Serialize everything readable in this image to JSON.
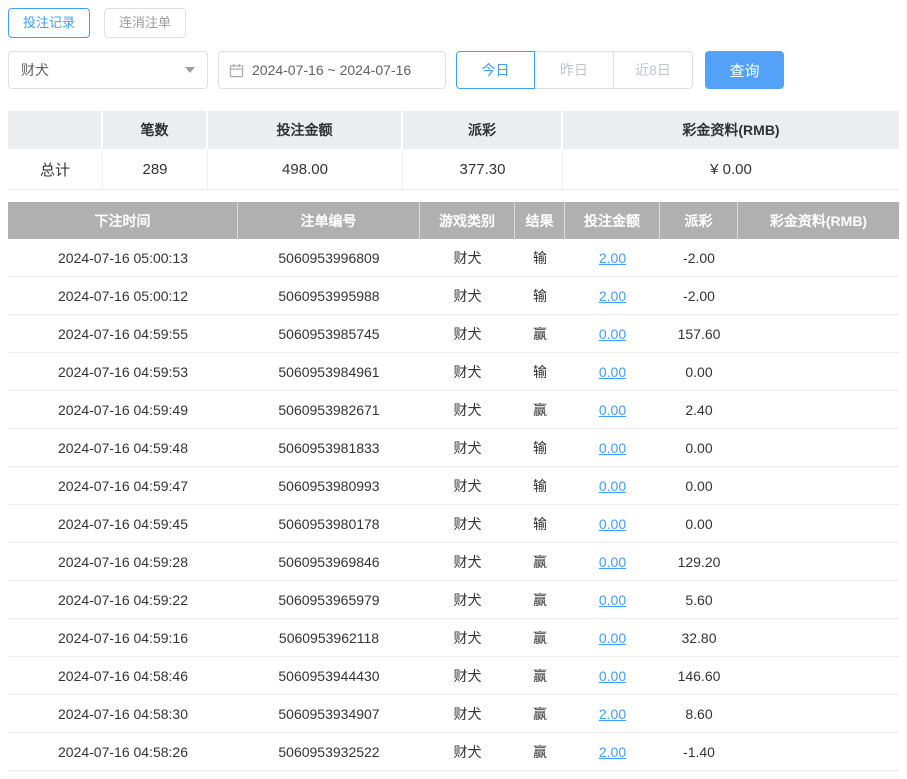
{
  "colors": {
    "accent": "#409eff",
    "search_button": "#53a2f7",
    "table_header_bg": "#b0b0b0",
    "summary_header_bg": "#ecedf1",
    "negative": "#ef5050",
    "link": "#409eff"
  },
  "icons": {
    "date_picker": "calendar-icon",
    "select_caret": "chevron-down-icon"
  },
  "tabs": [
    {
      "label": "投注记录",
      "active": true
    },
    {
      "label": "连消注单",
      "active": false
    }
  ],
  "filters": {
    "game_select": {
      "value": "财犬"
    },
    "date_range": "2024-07-16 ~ 2024-07-16",
    "quick_buttons": [
      {
        "label": "今日",
        "active": true
      },
      {
        "label": "昨日",
        "active": false
      },
      {
        "label": "近8日",
        "active": false
      }
    ],
    "search_label": "查询"
  },
  "summary": {
    "headers": [
      "",
      "笔数",
      "投注金额",
      "派彩",
      "彩金资料(RMB)"
    ],
    "row_label": "总计",
    "count": "289",
    "bet_amount": "498.00",
    "payout": "377.30",
    "bonus": "¥ 0.00"
  },
  "table": {
    "headers": [
      "下注时间",
      "注单编号",
      "游戏类别",
      "结果",
      "投注金额",
      "派彩",
      "彩金资料(RMB)"
    ],
    "rows": [
      {
        "time": "2024-07-16 05:00:13",
        "order_id": "5060953996809",
        "game": "财犬",
        "result": "输",
        "bet": "2.00",
        "payout": "-2.00",
        "bonus": ""
      },
      {
        "time": "2024-07-16 05:00:12",
        "order_id": "5060953995988",
        "game": "财犬",
        "result": "输",
        "bet": "2.00",
        "payout": "-2.00",
        "bonus": ""
      },
      {
        "time": "2024-07-16 04:59:55",
        "order_id": "5060953985745",
        "game": "财犬",
        "result": "赢",
        "bet": "0.00",
        "payout": "157.60",
        "bonus": ""
      },
      {
        "time": "2024-07-16 04:59:53",
        "order_id": "5060953984961",
        "game": "财犬",
        "result": "输",
        "bet": "0.00",
        "payout": "0.00",
        "bonus": ""
      },
      {
        "time": "2024-07-16 04:59:49",
        "order_id": "5060953982671",
        "game": "财犬",
        "result": "赢",
        "bet": "0.00",
        "payout": "2.40",
        "bonus": ""
      },
      {
        "time": "2024-07-16 04:59:48",
        "order_id": "5060953981833",
        "game": "财犬",
        "result": "输",
        "bet": "0.00",
        "payout": "0.00",
        "bonus": ""
      },
      {
        "time": "2024-07-16 04:59:47",
        "order_id": "5060953980993",
        "game": "财犬",
        "result": "输",
        "bet": "0.00",
        "payout": "0.00",
        "bonus": ""
      },
      {
        "time": "2024-07-16 04:59:45",
        "order_id": "5060953980178",
        "game": "财犬",
        "result": "输",
        "bet": "0.00",
        "payout": "0.00",
        "bonus": ""
      },
      {
        "time": "2024-07-16 04:59:28",
        "order_id": "5060953969846",
        "game": "财犬",
        "result": "赢",
        "bet": "0.00",
        "payout": "129.20",
        "bonus": ""
      },
      {
        "time": "2024-07-16 04:59:22",
        "order_id": "5060953965979",
        "game": "财犬",
        "result": "赢",
        "bet": "0.00",
        "payout": "5.60",
        "bonus": ""
      },
      {
        "time": "2024-07-16 04:59:16",
        "order_id": "5060953962118",
        "game": "财犬",
        "result": "赢",
        "bet": "0.00",
        "payout": "32.80",
        "bonus": ""
      },
      {
        "time": "2024-07-16 04:58:46",
        "order_id": "5060953944430",
        "game": "财犬",
        "result": "赢",
        "bet": "0.00",
        "payout": "146.60",
        "bonus": ""
      },
      {
        "time": "2024-07-16 04:58:30",
        "order_id": "5060953934907",
        "game": "财犬",
        "result": "赢",
        "bet": "2.00",
        "payout": "8.60",
        "bonus": ""
      },
      {
        "time": "2024-07-16 04:58:26",
        "order_id": "5060953932522",
        "game": "财犬",
        "result": "赢",
        "bet": "2.00",
        "payout": "-1.40",
        "bonus": ""
      }
    ]
  }
}
